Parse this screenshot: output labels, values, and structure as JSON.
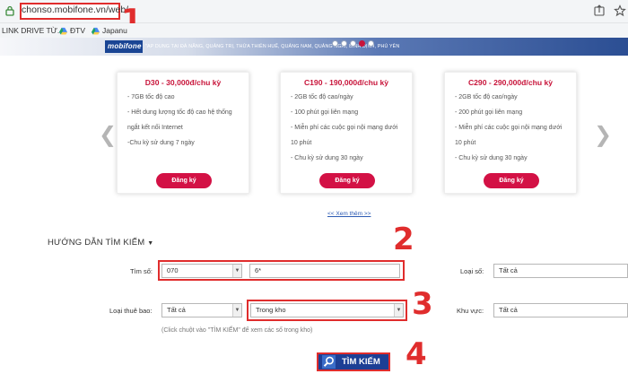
{
  "browser": {
    "url": "chonso.mobifone.vn/web/",
    "bookmarks": [
      {
        "label": "LINK DRIVE TỪ..."
      },
      {
        "label": "ĐTV"
      },
      {
        "label": "Japanu"
      }
    ]
  },
  "annotations": [
    "1",
    "2",
    "3",
    "4"
  ],
  "banner": {
    "logo": "mobifone",
    "text": "\"AP DUNG TẠI ĐÀ NẴNG, QUẢNG TRỊ, THỪA THIÊN HUẾ, QUẢNG NAM, QUẢNG NGÃI, BÌNH ĐỊNH, PHÚ YÊN",
    "accent_color": "#c8143a"
  },
  "packages": [
    {
      "title": "D30 - 30,000đ/chu kỳ",
      "lines": [
        "- 7GB tốc độ cao",
        "- Hết dung lượng tốc độ cao hệ thống",
        "ngắt kết nối Internet",
        "-Chu kỳ sử dung 7 ngày"
      ],
      "button": "Đăng ký"
    },
    {
      "title": "C190 - 190,000đ/chu kỳ",
      "lines": [
        "- 2GB tốc độ cao/ngày",
        "- 100 phút gọi liên mạng",
        "- Miễn phí các cuộc gọi nội mạng dưới",
        "10 phút",
        "- Chu kỳ sử dung 30 ngày"
      ],
      "button": "Đăng ký"
    },
    {
      "title": "C290 - 290,000đ/chu kỳ",
      "lines": [
        "- 2GB tốc độ cao/ngày",
        "- 200 phút gọi liên mạng",
        "- Miễn phí các cuộc gọi nội mạng dưới",
        "10 phút",
        "- Chu kỳ sử dung 30 ngày"
      ],
      "button": "Đăng ký"
    }
  ],
  "more_link": "<< Xem thêm >>",
  "search": {
    "heading": "HƯỚNG DẪN TÌM KIẾM",
    "tim_so_label": "Tìm số:",
    "prefix_value": "070",
    "number_value": "6*",
    "loai_so_label": "Loại số:",
    "loai_so_value": "Tất cả",
    "loai_thue_bao_label": "Loại thuê bao:",
    "loai_thue_bao_value": "Tất cả",
    "kho_value": "Trong kho",
    "khu_vuc_label": "Khu vực:",
    "khu_vuc_value": "Tất cả",
    "hint": "(Click chuột vào \"TÌM KIẾM\" để xem các số trong kho)",
    "button": "TÌM KIẾM"
  }
}
